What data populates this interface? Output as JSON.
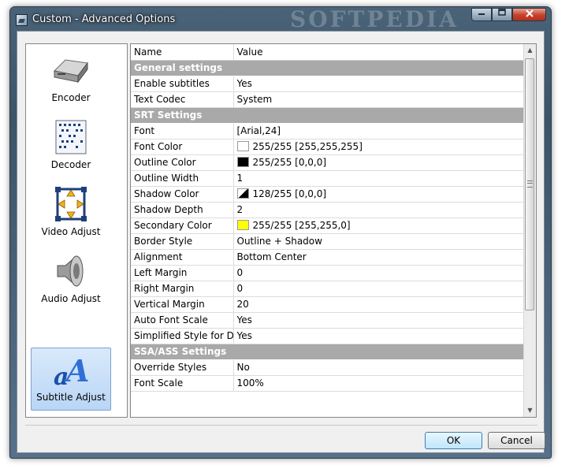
{
  "window": {
    "title": "Custom - Advanced Options",
    "watermark": "SOFTPEDIA",
    "controls": {
      "minimize": "minimize-icon",
      "maximize": "maximize-icon",
      "close": "close-icon"
    }
  },
  "sidebar": {
    "items": [
      {
        "label": "Encoder",
        "icon": "encoder-icon"
      },
      {
        "label": "Decoder",
        "icon": "decoder-icon"
      },
      {
        "label": "Video Adjust",
        "icon": "video-adjust-icon"
      },
      {
        "label": "Audio Adjust",
        "icon": "audio-adjust-icon"
      },
      {
        "label": "Subtitle Adjust",
        "icon": "subtitle-adjust-icon",
        "selected": true
      }
    ]
  },
  "grid": {
    "columns": {
      "name": "Name",
      "value": "Value"
    },
    "rows": [
      {
        "section": "General settings"
      },
      {
        "name": "Enable subtitles",
        "value": "Yes"
      },
      {
        "name": "Text Codec",
        "value": "System"
      },
      {
        "section": "SRT Settings"
      },
      {
        "name": "Font",
        "value": "[Arial,24]"
      },
      {
        "name": "Font Color",
        "value": "255/255 [255,255,255]",
        "swatch": "#ffffff"
      },
      {
        "name": "Outline Color",
        "value": "255/255 [0,0,0]",
        "swatch": "#000000"
      },
      {
        "name": "Outline Width",
        "value": "1"
      },
      {
        "name": "Shadow Color",
        "value": "128/255 [0,0,0]",
        "swatch": "#000000",
        "half": true
      },
      {
        "name": "Shadow Depth",
        "value": "2"
      },
      {
        "name": "Secondary Color",
        "value": "255/255 [255,255,0]",
        "swatch": "#ffff00"
      },
      {
        "name": "Border Style",
        "value": "Outline + Shadow"
      },
      {
        "name": "Alignment",
        "value": "Bottom Center"
      },
      {
        "name": "Left Margin",
        "value": "0"
      },
      {
        "name": "Right Margin",
        "value": "0"
      },
      {
        "name": "Vertical Margin",
        "value": "20"
      },
      {
        "name": "Auto Font Scale",
        "value": "Yes"
      },
      {
        "name": "Simplified Style for D...",
        "value": "Yes"
      },
      {
        "section": "SSA/ASS Settings"
      },
      {
        "name": "Override Styles",
        "value": "No"
      },
      {
        "name": "Font Scale",
        "value": "100%"
      }
    ]
  },
  "buttons": {
    "ok": "OK",
    "cancel": "Cancel"
  }
}
